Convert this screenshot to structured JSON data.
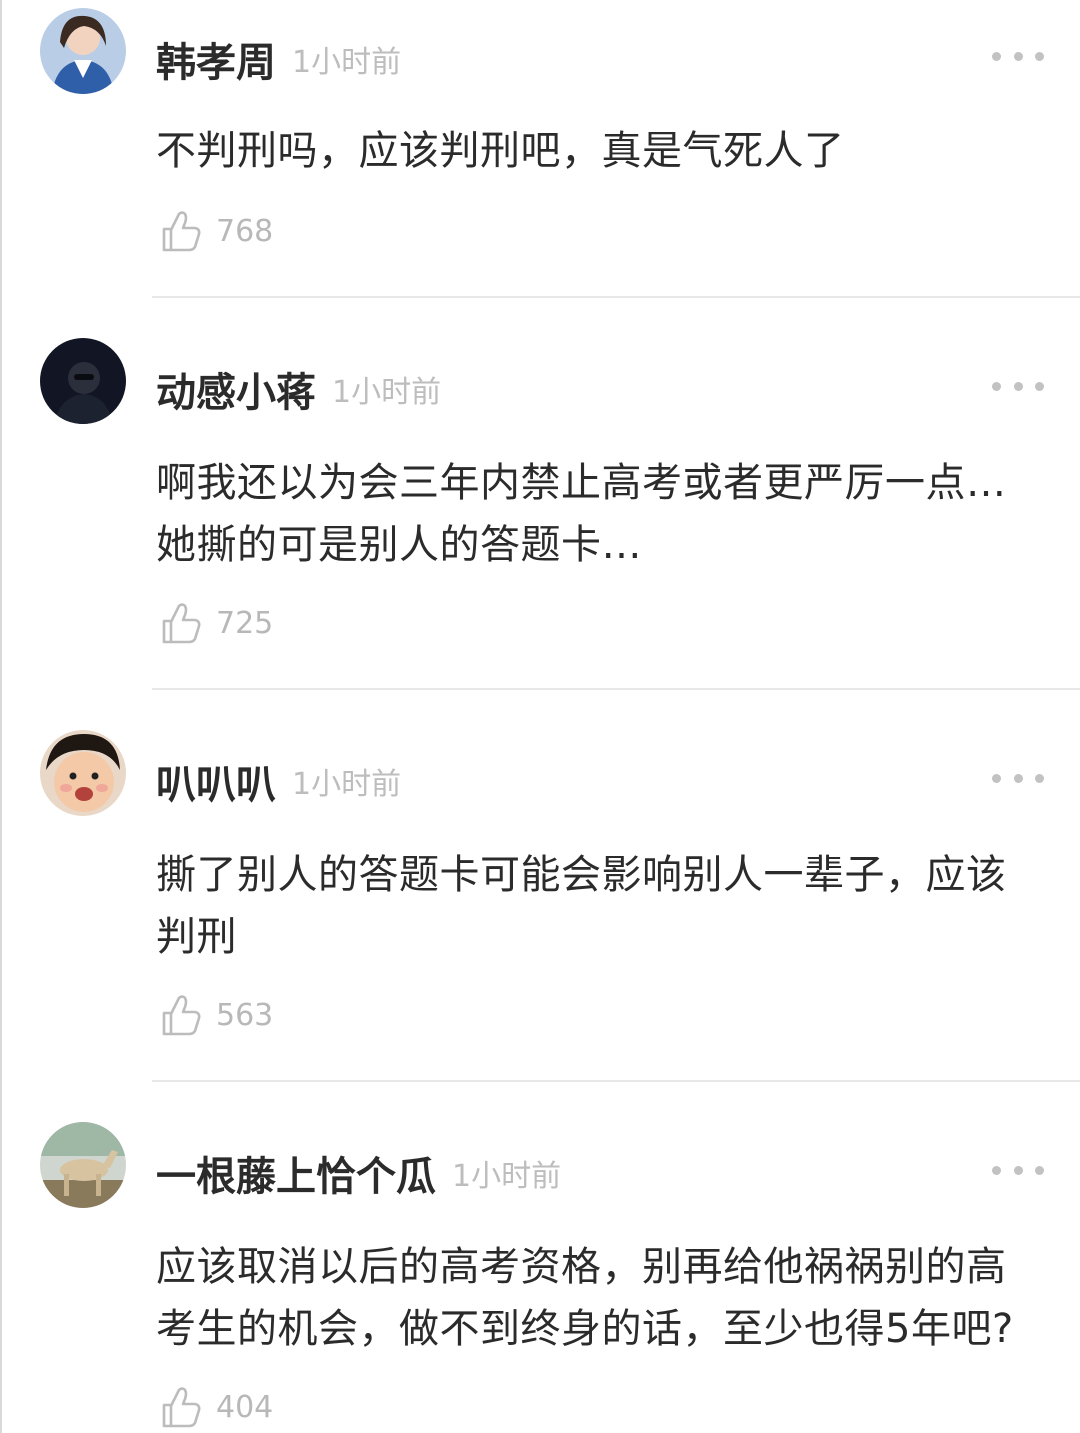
{
  "comments": [
    {
      "username": "韩孝周",
      "time": "1小时前",
      "text": "不判刑吗，应该判刑吧，真是气死人了",
      "likes": "768",
      "avatar": "woman-avatar"
    },
    {
      "username": "动感小蒋",
      "time": "1小时前",
      "text": "啊我还以为会三年内禁止高考或者更严厉一点…她撕的可是别人的答题卡…",
      "likes": "725",
      "avatar": "dark-avatar"
    },
    {
      "username": "叭叭叭",
      "time": "1小时前",
      "text": "撕了别人的答题卡可能会影响别人一辈子，应该判刑",
      "likes": "563",
      "avatar": "baby-avatar"
    },
    {
      "username": "一根藤上恰个瓜",
      "time": "1小时前",
      "text": "应该取消以后的高考资格，别再给他祸祸别的高考生的机会，做不到终身的话，至少也得5年吧?",
      "likes": "404",
      "avatar": "horse-avatar"
    }
  ],
  "icons": {
    "like": "thumbs-up-icon",
    "more": "more-icon"
  },
  "colors": {
    "username": "#2b2b2b",
    "time": "#bdbdbd",
    "likes": "#b8b8b8",
    "divider": "#e8e8e8"
  }
}
